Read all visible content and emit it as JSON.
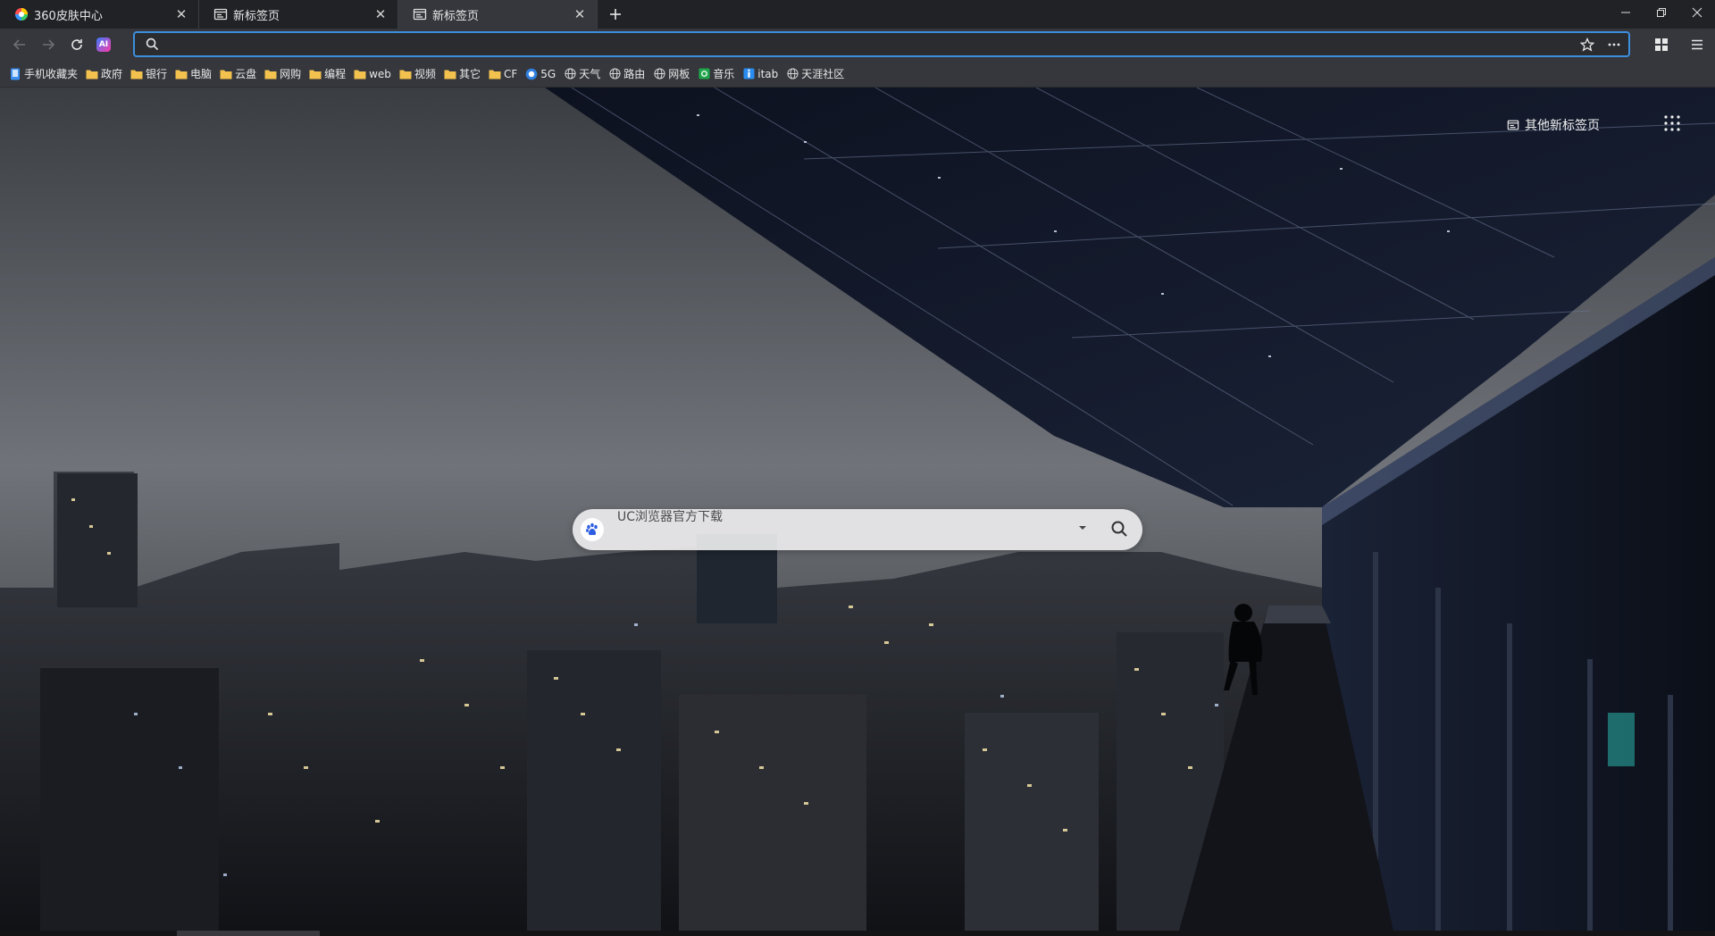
{
  "tabs": [
    {
      "label": "360皮肤中心",
      "icon": "colorful-360-skin-icon",
      "active": false
    },
    {
      "label": "新标签页",
      "icon": "new-tab-page-icon",
      "active": false
    },
    {
      "label": "新标签页",
      "icon": "new-tab-page-icon",
      "active": true
    }
  ],
  "omnibox": {
    "value": "",
    "placeholder": ""
  },
  "bookmarks": [
    {
      "label": "手机收藏夹",
      "icon": "mobile-bookmarks-icon"
    },
    {
      "label": "政府",
      "icon": "folder-icon"
    },
    {
      "label": "银行",
      "icon": "folder-icon"
    },
    {
      "label": "电脑",
      "icon": "folder-icon"
    },
    {
      "label": "云盘",
      "icon": "folder-icon"
    },
    {
      "label": "网购",
      "icon": "folder-icon"
    },
    {
      "label": "编程",
      "icon": "folder-icon"
    },
    {
      "label": "web",
      "icon": "folder-icon"
    },
    {
      "label": "视频",
      "icon": "folder-icon"
    },
    {
      "label": "其它",
      "icon": "folder-icon"
    },
    {
      "label": "CF",
      "icon": "folder-icon"
    },
    {
      "label": "5G",
      "icon": "5g-site-icon"
    },
    {
      "label": "天气",
      "icon": "globe-icon"
    },
    {
      "label": "路由",
      "icon": "globe-icon"
    },
    {
      "label": "网板",
      "icon": "globe-icon"
    },
    {
      "label": "音乐",
      "icon": "music-site-icon"
    },
    {
      "label": "itab",
      "icon": "itab-site-icon"
    },
    {
      "label": "天涯社区",
      "icon": "globe-icon"
    }
  ],
  "newtab": {
    "other_ntp_label": "其他新标签页",
    "search_hint": "UC浏览器官方下载",
    "search_engine_icon": "baidu-paw-icon"
  },
  "colors": {
    "accent": "#3c8fdc",
    "tab_strip": "#202226",
    "toolbar": "#35373c",
    "folder": "#f2c14e"
  }
}
